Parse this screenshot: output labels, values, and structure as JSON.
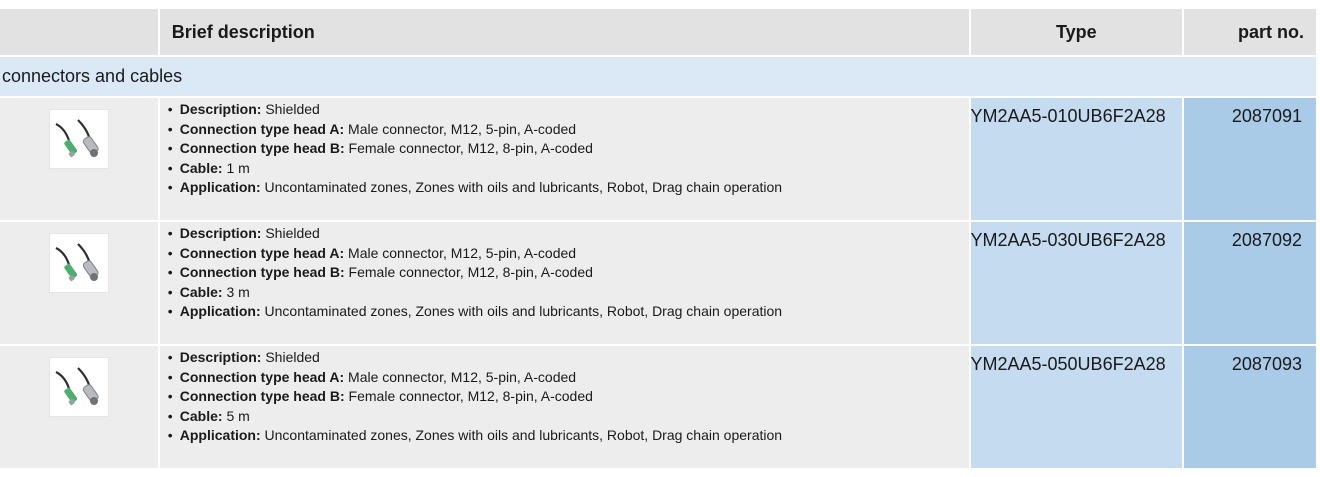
{
  "header": {
    "description": "Brief description",
    "type": "Type",
    "part_no": "part no."
  },
  "group": {
    "title": "connectors and cables"
  },
  "rows": [
    {
      "image_icon": "cable-connector-icon",
      "specs": [
        {
          "label": "Description:",
          "value": "Shielded"
        },
        {
          "label": "Connection type head A:",
          "value": "Male connector, M12, 5-pin, A-coded"
        },
        {
          "label": "Connection type head B:",
          "value": "Female connector, M12, 8-pin, A-coded"
        },
        {
          "label": "Cable:",
          "value": "1 m"
        },
        {
          "label": "Application:",
          "value": "Uncontaminated zones, Zones with oils and lubricants, Robot, Drag chain operation"
        }
      ],
      "type": "YM2AA5-010UB6F2A28",
      "part_no": "2087091"
    },
    {
      "image_icon": "cable-connector-icon",
      "specs": [
        {
          "label": "Description:",
          "value": "Shielded"
        },
        {
          "label": "Connection type head A:",
          "value": "Male connector, M12, 5-pin, A-coded"
        },
        {
          "label": "Connection type head B:",
          "value": "Female connector, M12, 8-pin, A-coded"
        },
        {
          "label": "Cable:",
          "value": "3 m"
        },
        {
          "label": "Application:",
          "value": "Uncontaminated zones, Zones with oils and lubricants, Robot, Drag chain operation"
        }
      ],
      "type": "YM2AA5-030UB6F2A28",
      "part_no": "2087092"
    },
    {
      "image_icon": "cable-connector-icon",
      "specs": [
        {
          "label": "Description:",
          "value": "Shielded"
        },
        {
          "label": "Connection type head A:",
          "value": "Male connector, M12, 5-pin, A-coded"
        },
        {
          "label": "Connection type head B:",
          "value": "Female connector, M12, 8-pin, A-coded"
        },
        {
          "label": "Cable:",
          "value": "5 m"
        },
        {
          "label": "Application:",
          "value": "Uncontaminated zones, Zones with oils and lubricants, Robot, Drag chain operation"
        }
      ],
      "type": "YM2AA5-050UB6F2A28",
      "part_no": "2087093"
    }
  ],
  "colors": {
    "header_bg": "#e2e2e2",
    "group_bg": "#dae9f5",
    "row_bg": "#ededed",
    "type_bg": "#c4dbf0",
    "part_bg": "#a9cbe8",
    "connector_green": "#4caf6e"
  }
}
